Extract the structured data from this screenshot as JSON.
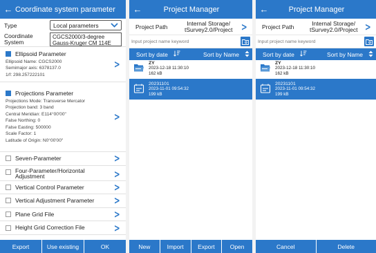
{
  "panel1": {
    "title": "Coordinate system parameter",
    "type_label": "Type",
    "type_value": "Local parameters",
    "cs_label_1": "Coordinate",
    "cs_label_2": "System",
    "cs_value_1": "CGCS2000/3-degree",
    "cs_value_2": "Gauss-Kruger CM 114E",
    "ellipsoid": {
      "title": "Ellipsoid Parameter",
      "checked": true,
      "lines": [
        "Ellipsoid Name: CGCS2000",
        "Semimajor axis: 6378137.0",
        "1/f: 298.257222101"
      ]
    },
    "projection": {
      "title": "Projections Parameter",
      "checked": true,
      "lines": [
        "Projections Mode: Transverse Mercator",
        "Projection band: 3 band",
        "Central Meridian: E114°00'00\"",
        "False Northing: 0",
        "False Easting: 500000",
        "Scale Factor: 1",
        "Latitude of Origin: N0°00'00\""
      ]
    },
    "items": [
      {
        "label": "Seven-Parameter"
      },
      {
        "label": "Four-Parameter/Horizontal Adjustment"
      },
      {
        "label": "Vertical Control Parameter"
      },
      {
        "label": "Vertical Adjustment Parameter"
      },
      {
        "label": "Plane Grid File"
      },
      {
        "label": "Height Grid Correction File"
      }
    ],
    "buttons": {
      "export": "Export",
      "use_existing": "Use existing",
      "ok": "OK"
    }
  },
  "panel2": {
    "title": "Project Manager",
    "path_label": "Project Path",
    "path_value_1": "Internal Storage/",
    "path_value_2": "tSurvey2.0/Project",
    "search_placeholder": "Input project name keyword",
    "sort_date": "Sort by date",
    "sort_name": "Sort by Name",
    "projects": [
      {
        "name": "ZY",
        "date": "2023-12-18 11:30:10",
        "size": "162 kB",
        "selected": false
      },
      {
        "name": "20231101",
        "date": "2023-11-01 09:54:32",
        "size": "199 kB",
        "selected": true
      }
    ],
    "buttons": {
      "new": "New",
      "import": "Import",
      "export": "Export",
      "open": "Open"
    }
  },
  "panel3": {
    "title": "Project Manager",
    "path_label": "Project Path",
    "path_value_1": "Internal Storage/",
    "path_value_2": "tSurvey2.0/Project",
    "search_placeholder": "Input project name keyword",
    "sort_date": "Sort by date",
    "sort_name": "Sort by Name",
    "projects": [
      {
        "name": "ZY",
        "date": "2023-12-18 11:30:10",
        "size": "162 kB",
        "selected": false
      },
      {
        "name": "20231101",
        "date": "2023-11-01 09:54:32",
        "size": "199 kB",
        "selected": true
      }
    ],
    "buttons": {
      "cancel": "Cancel",
      "delete": "Delete"
    }
  },
  "colors": {
    "accent": "#2b78c9",
    "background": "#ffffff",
    "divider": "#e0e0e0"
  }
}
